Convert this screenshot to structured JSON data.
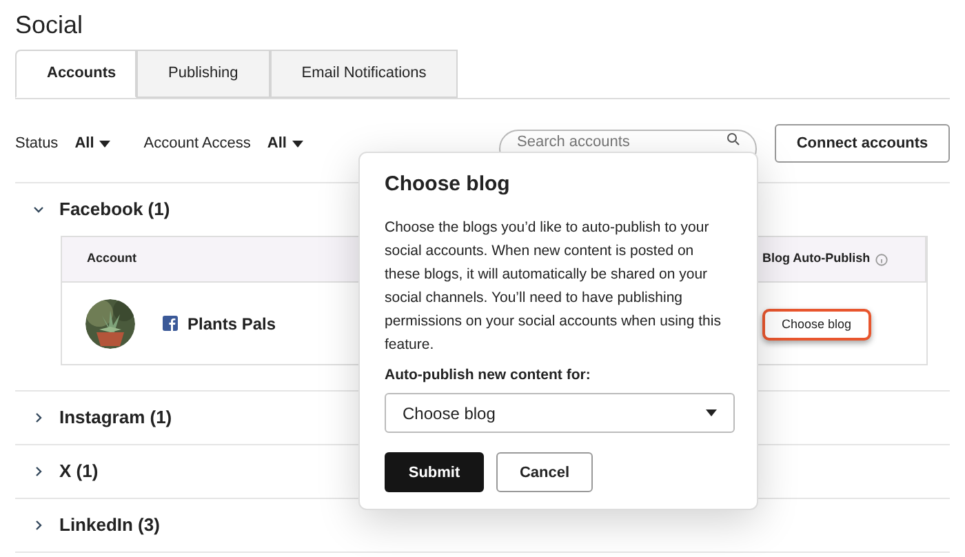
{
  "title": "Social",
  "tabs": [
    {
      "label": "Accounts",
      "selected": true
    },
    {
      "label": "Publishing",
      "selected": false
    },
    {
      "label": "Email Notifications",
      "selected": false
    }
  ],
  "filters": [
    {
      "label": "Status",
      "value": "All"
    },
    {
      "label": "Account Access",
      "value": "All"
    }
  ],
  "search": {
    "placeholder": "Search accounts"
  },
  "connect_button": "Connect accounts",
  "networks": [
    {
      "name": "Facebook (1)",
      "expanded": true,
      "columns": [
        "Account",
        "Blog Auto-Publish"
      ],
      "accounts": [
        {
          "name": "Plants Pals",
          "action": "Choose blog",
          "highlighted": true
        }
      ]
    },
    {
      "name": "Instagram (1)",
      "expanded": false
    },
    {
      "name": "X (1)",
      "expanded": false
    },
    {
      "name": "LinkedIn (3)",
      "expanded": false
    }
  ],
  "popover": {
    "title": "Choose blog",
    "body": "Choose the blogs you’d like to auto-publish to your social accounts. When new content is posted on these blogs, it will automatically be shared on your social channels. You’ll need to have publishing permissions on your social accounts when using this feature.",
    "field_label": "Auto-publish new content for:",
    "select_value": "Choose blog",
    "submit": "Submit",
    "cancel": "Cancel"
  }
}
